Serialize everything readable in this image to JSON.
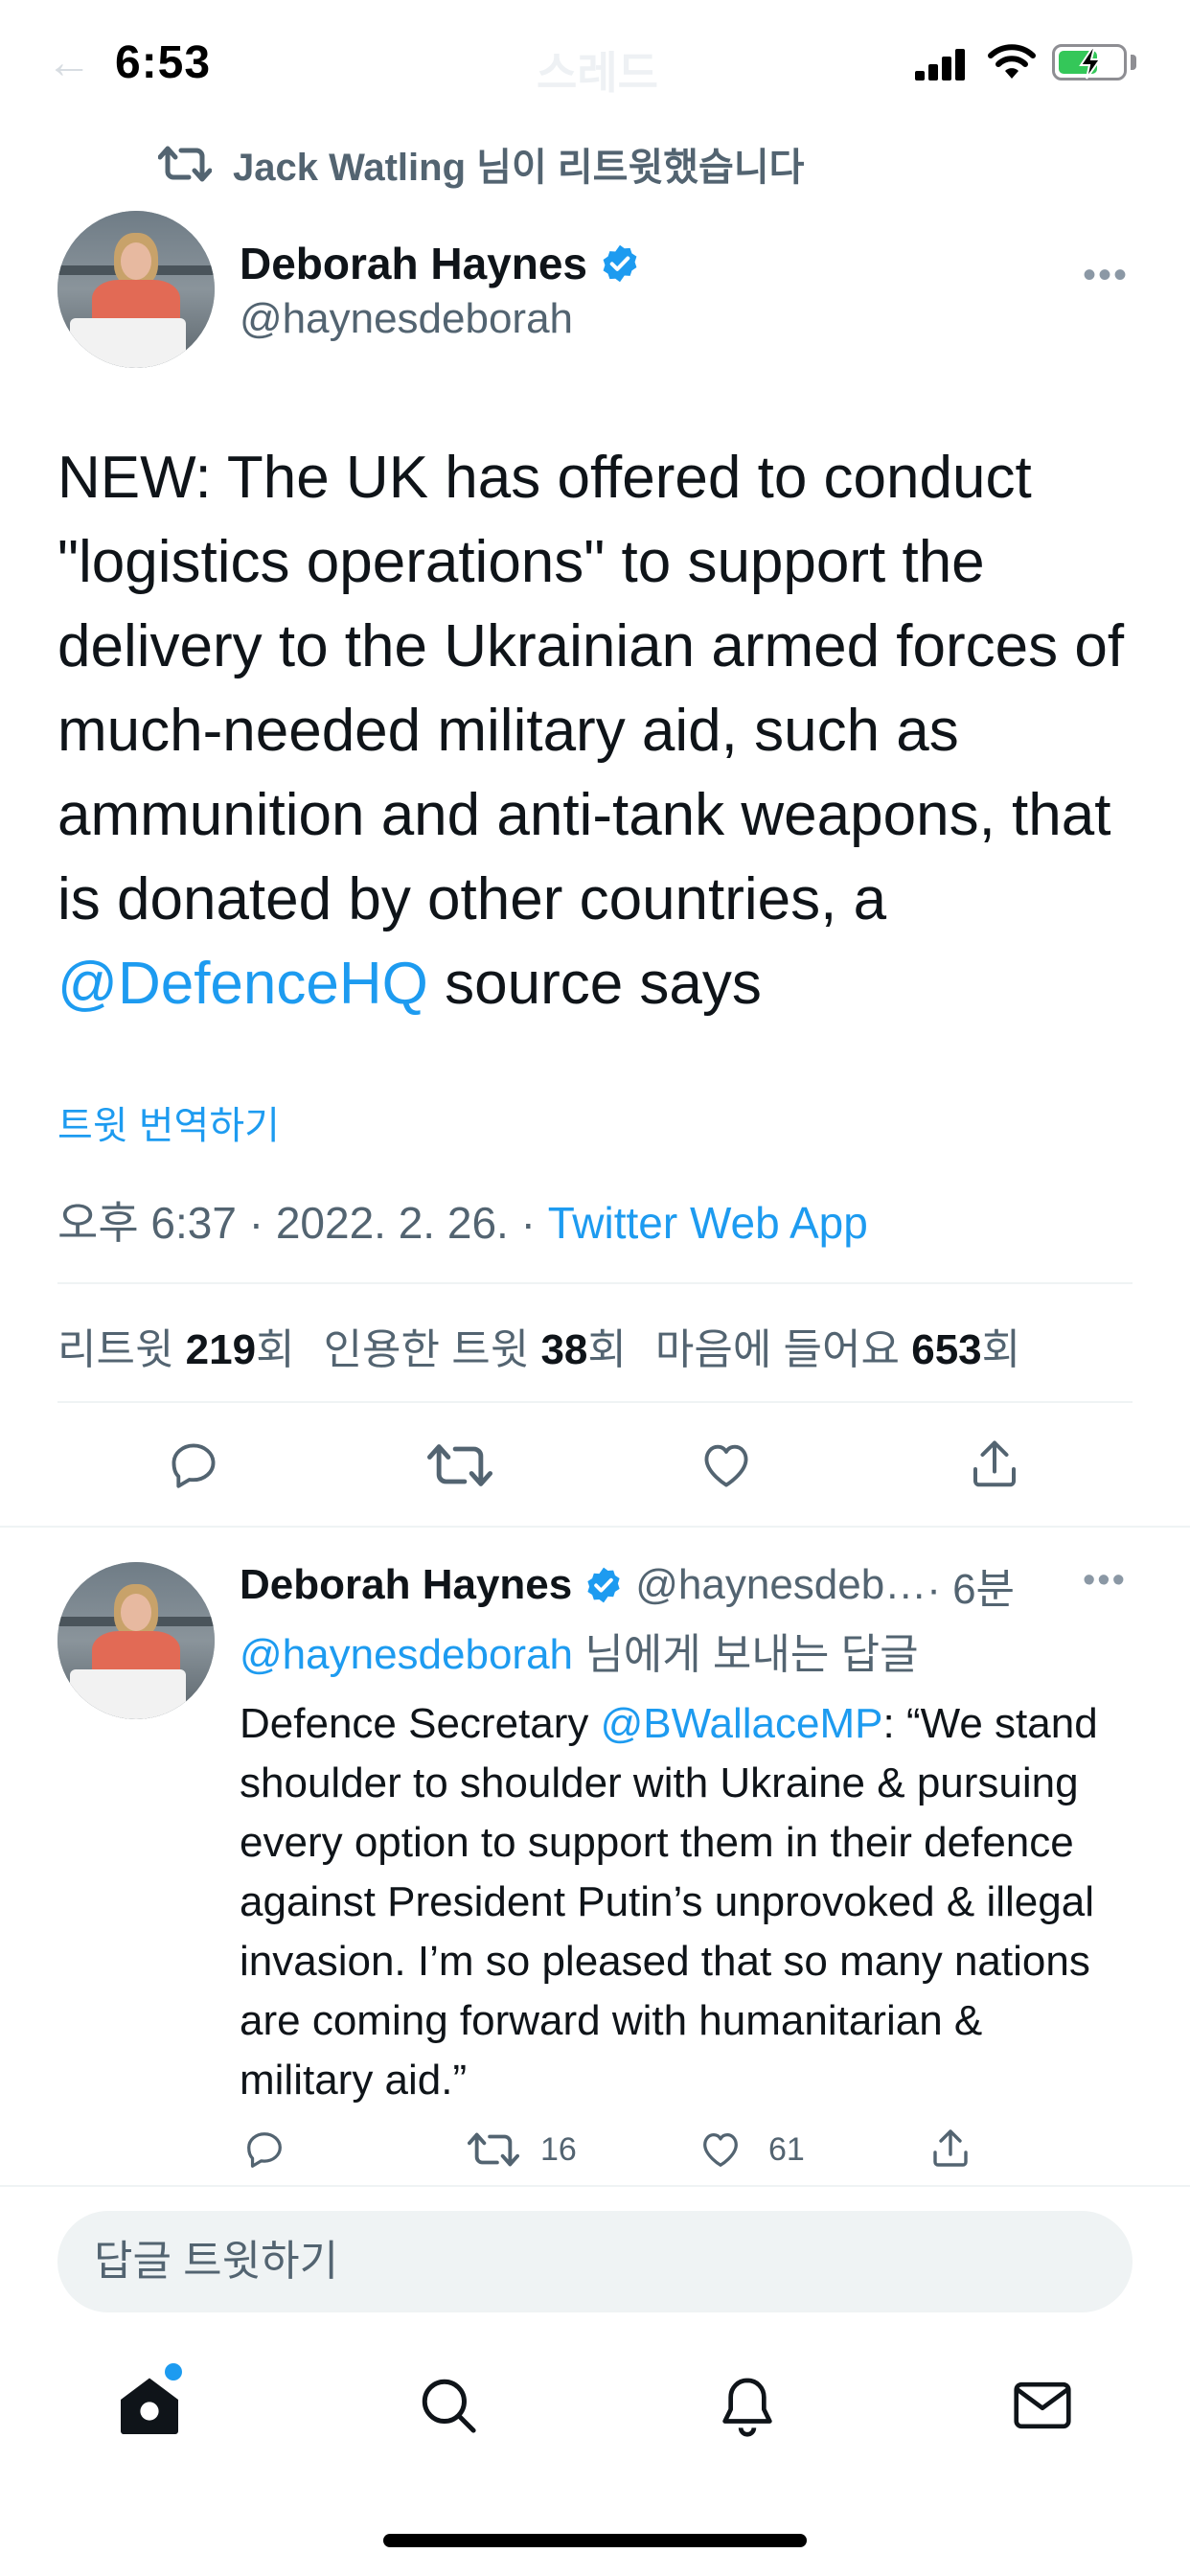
{
  "status_bar": {
    "time": "6:53",
    "ghost_back": "←",
    "ghost_title": "스레드"
  },
  "retweet_header": {
    "text": "Jack Watling 님이 리트윗했습니다"
  },
  "main_tweet": {
    "author_name": "Deborah Haynes",
    "author_handle": "@haynesdeborah",
    "more": "•••",
    "text_before_mention": "NEW: The UK has offered to conduct \"logistics operations\" to support the delivery to the Ukrainian armed forces of much-needed military aid, such as ammunition and anti-tank weapons, that is donated by other countries, a ",
    "mention": "@DefenceHQ",
    "text_after_mention": " source says",
    "translate_label": "트윗 번역하기",
    "timestamp": "오후 6:37 · 2022. 2. 26. · ",
    "source": "Twitter Web App",
    "stats": {
      "retweets_label": "리트윗 ",
      "retweets_count": "219",
      "retweets_suffix": "회",
      "quotes_label": "인용한 트윗 ",
      "quotes_count": "38",
      "quotes_suffix": "회",
      "likes_label": "마음에 들어요 ",
      "likes_count": "653",
      "likes_suffix": "회"
    }
  },
  "reply_tweet": {
    "author_name": "Deborah Haynes",
    "author_handle": "@haynesdeb…",
    "time_ago": " · 6분",
    "more": "•••",
    "reply_to_handle": "@haynesdeborah",
    "reply_to_suffix": " 님에게 보내는 답글",
    "text_before_mention": "Defence Secretary ",
    "mention": "@BWallaceMP",
    "text_after_mention": ": “We stand shoulder to shoulder with Ukraine & pursuing every option to support them in their defence against President Putin’s unprovoked & illegal invasion. I’m so pleased that so many nations are coming forward with humanitarian & military aid.”",
    "retweet_count": "16",
    "like_count": "61"
  },
  "reply_input": {
    "placeholder": "답글 트윗하기"
  },
  "tab_bar": {
    "icons": [
      "home-icon",
      "search-icon",
      "notifications-icon",
      "messages-icon"
    ],
    "home_has_new": true
  },
  "colors": {
    "accent": "#1d9bf0",
    "secondary_text": "#536471",
    "divider": "#eff3f4"
  }
}
